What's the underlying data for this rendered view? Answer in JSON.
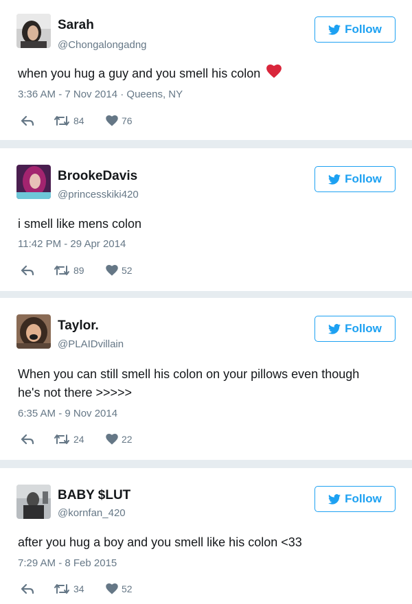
{
  "tweets": [
    {
      "name": "Sarah",
      "handle": "@Chongalongadng",
      "follow_label": "Follow",
      "text": "when you hug a guy and you smell his colon",
      "meta": "3:36 AM - 7 Nov 2014 · Queens, NY",
      "retweets": "84",
      "likes": "76"
    },
    {
      "name": "BrookeDavis",
      "handle": "@princesskiki420",
      "follow_label": "Follow",
      "text": "i smell like mens colon",
      "meta": "11:42 PM - 29 Apr 2014",
      "retweets": "89",
      "likes": "52"
    },
    {
      "name": "Taylor.",
      "handle": "@PLAIDvillain",
      "follow_label": "Follow",
      "text": "When you can still smell his colon on your pillows even though he's not there >>>>>",
      "meta": "6:35 AM - 9 Nov 2014",
      "retweets": "24",
      "likes": "22"
    },
    {
      "name": "BABY $LUT",
      "handle": "@kornfan_420",
      "follow_label": "Follow",
      "text": "after you hug a boy and you smell like his colon <33",
      "meta": "7:29 AM - 8 Feb 2015",
      "retweets": "34",
      "likes": "52"
    }
  ],
  "colors": {
    "twitter_blue": "#1da1f2",
    "muted_gray": "#657786",
    "background": "#e6ecf0",
    "emoji_heart": "#d9263b"
  },
  "icons": [
    "twitter-bird-icon",
    "reply-icon",
    "retweet-icon",
    "like-icon",
    "red-heart-emoji"
  ]
}
